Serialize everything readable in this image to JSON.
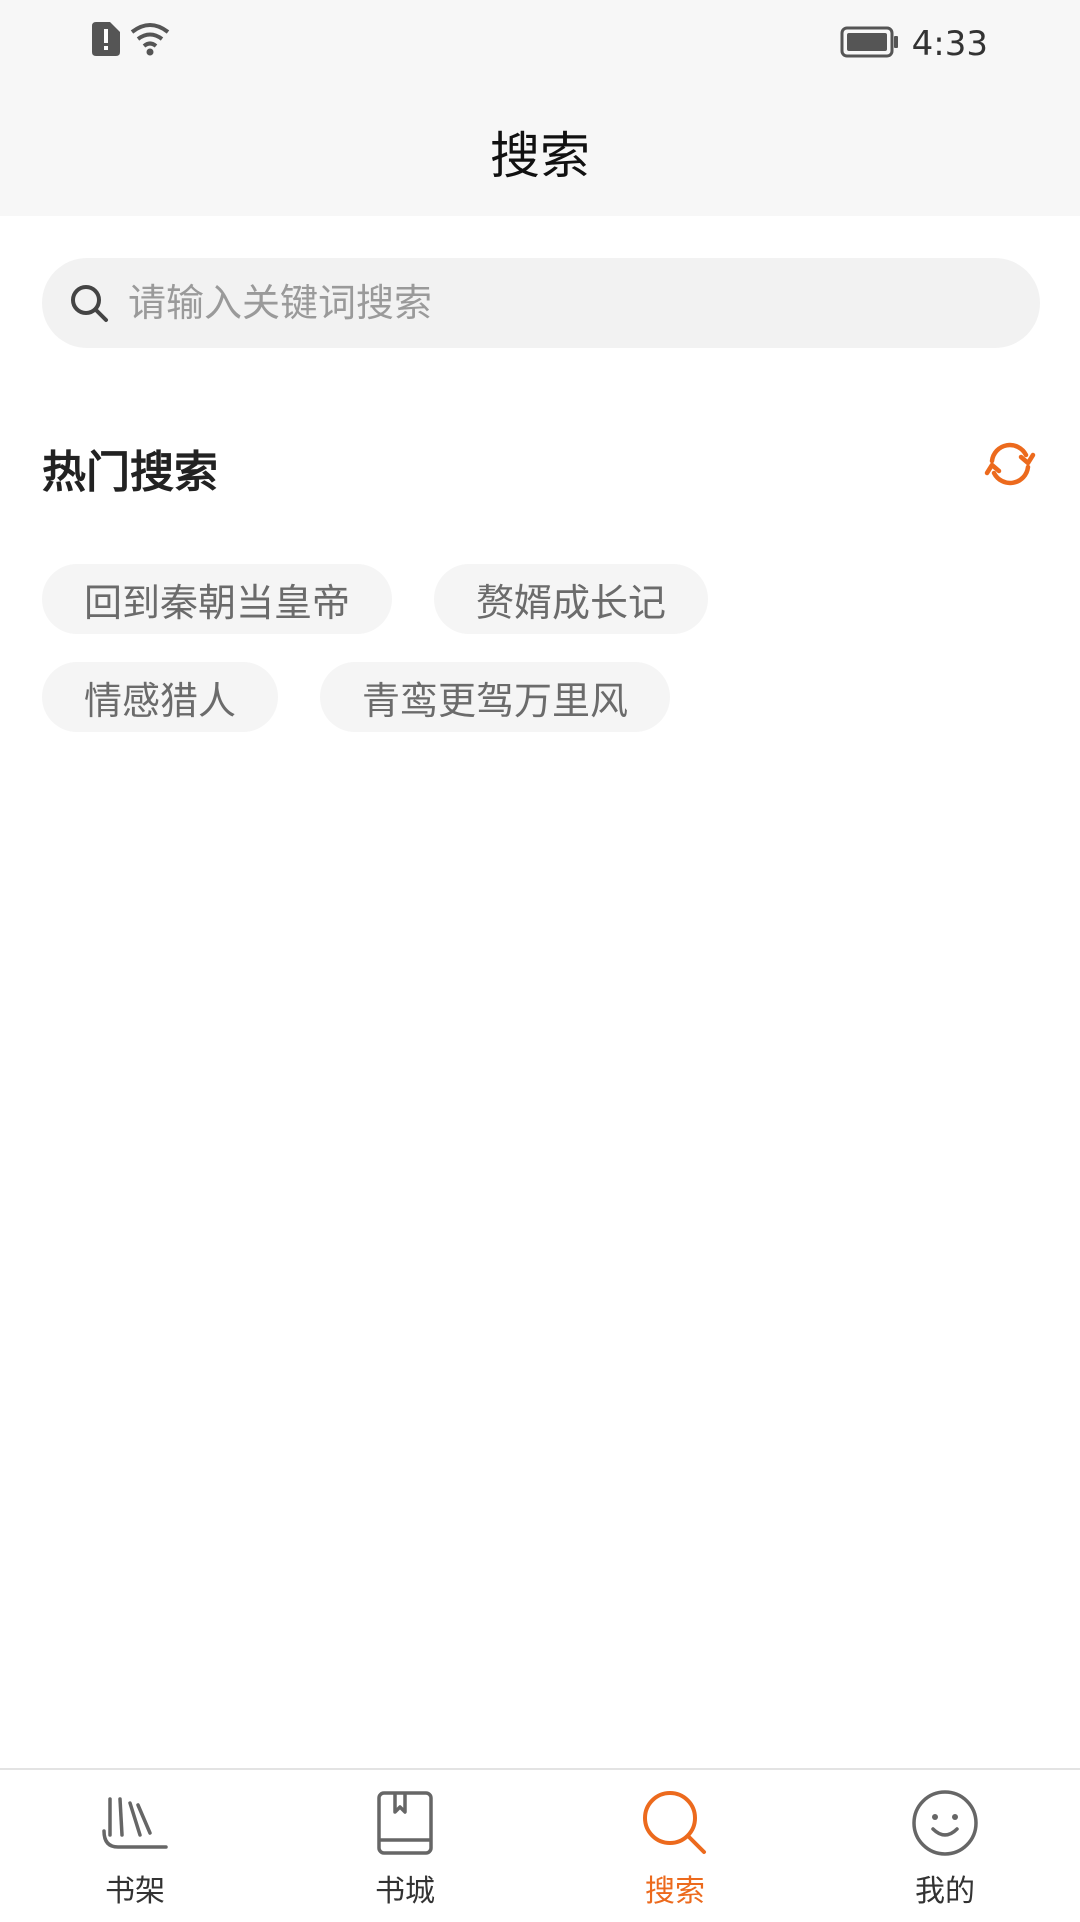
{
  "status_bar": {
    "time": "4:33",
    "left_icons": [
      "sim-alert-icon",
      "wifi-icon"
    ],
    "right_icons": [
      "battery-icon"
    ]
  },
  "header": {
    "title": "搜索"
  },
  "search": {
    "placeholder": "请输入关键词搜索",
    "value": ""
  },
  "hot_search": {
    "title": "热门搜索",
    "refresh_icon": "refresh-icon",
    "tags": [
      "回到秦朝当皇帝",
      "赘婿成长记",
      "情感猎人",
      "青鸾更驾万里风"
    ]
  },
  "bottom_nav": {
    "items": [
      {
        "label": "书架",
        "icon": "bookshelf-icon",
        "active": false
      },
      {
        "label": "书城",
        "icon": "bookstore-icon",
        "active": false
      },
      {
        "label": "搜索",
        "icon": "search-icon",
        "active": true
      },
      {
        "label": "我的",
        "icon": "profile-face-icon",
        "active": false
      }
    ]
  },
  "colors": {
    "accent": "#ec6a1d",
    "text_primary": "#222222",
    "tag_bg": "#f5f5f5",
    "header_bg": "#f7f7f7"
  }
}
